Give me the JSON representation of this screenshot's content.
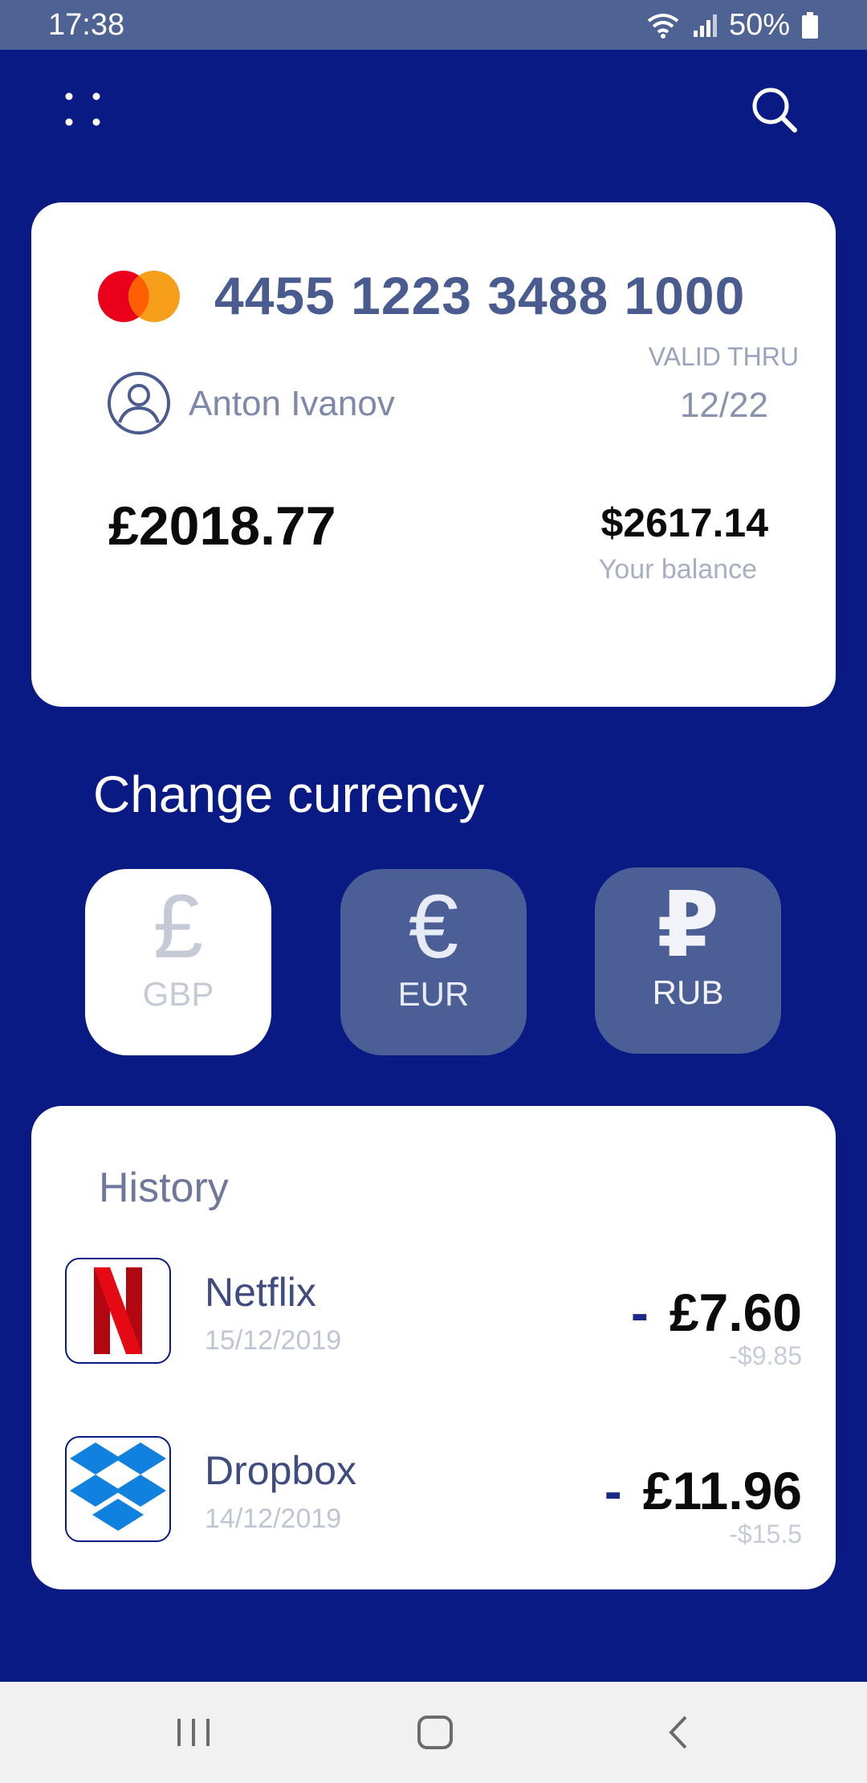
{
  "status_bar": {
    "time": "17:38",
    "battery": "50%",
    "icons": [
      "wifi-icon",
      "signal-icon",
      "battery-icon"
    ]
  },
  "topbar": {
    "menu_icon": "dots-grid-icon",
    "search_icon": "search-icon"
  },
  "card": {
    "brand": "mastercard-logo",
    "number": "4455 1223 3488 1000",
    "valid_label": "VALID THRU",
    "valid_date": "12/22",
    "holder": "Anton Ivanov",
    "balance_main": "£2018.77",
    "balance_usd": "$2617.14",
    "balance_label": "Your balance"
  },
  "currency": {
    "title": "Change currency",
    "options": [
      {
        "symbol": "£",
        "code": "GBP",
        "selected": true
      },
      {
        "symbol": "€",
        "code": "EUR",
        "selected": false
      },
      {
        "symbol": "₽",
        "code": "RUB",
        "selected": false
      }
    ]
  },
  "history": {
    "title": "History",
    "items": [
      {
        "name": "Netflix",
        "date": "15/12/2019",
        "minus": "-",
        "amount": "£7.60",
        "sub": "-$9.85",
        "logo": "netflix-logo"
      },
      {
        "name": "Dropbox",
        "date": "14/12/2019",
        "minus": "-",
        "amount": "£11.96",
        "sub": "-$15.5",
        "logo": "dropbox-logo"
      }
    ]
  },
  "colors": {
    "background": "#0A1A84",
    "status_bar": "#4E6294",
    "card_number": "#4A5C8F",
    "currency_button": "#4B5F96"
  }
}
